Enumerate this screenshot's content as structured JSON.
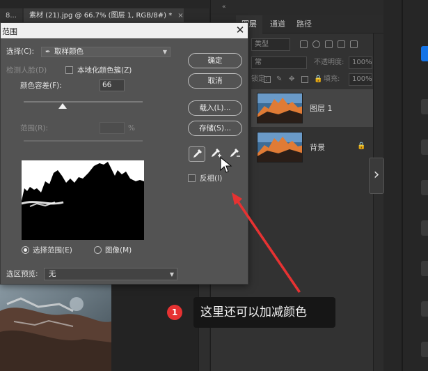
{
  "document_tabs": [
    {
      "label": "8..."
    },
    {
      "label": "素材 (21).jpg @ 66.7% (图层 1, RGB/8#) *",
      "close": "×"
    }
  ],
  "panel": {
    "tabs": [
      "图层",
      "通道",
      "路径"
    ],
    "filter_kind": "类型",
    "blend_mode": "常",
    "opacity_label": "不透明度:",
    "opacity_value": "100%",
    "lock_label": "锁定:",
    "fill_label": "填充:",
    "fill_value": "100%",
    "layers": [
      {
        "name": "图层 1",
        "selected": true
      },
      {
        "name": "背景",
        "locked": true
      }
    ]
  },
  "dialog": {
    "title": "范围",
    "select_label": "选择(C):",
    "select_value": "取样颜色",
    "detect_faces_label": "检测人脸(D)",
    "localized_clusters_label": "本地化颜色簇(Z)",
    "fuzziness_label": "颜色容差(F):",
    "fuzziness_value": "66",
    "fuzziness_level": 0.33,
    "range_label": "范围(R):",
    "range_unit": "%",
    "radio_selection": "选择范围(E)",
    "radio_image": "图像(M)",
    "preview_label": "选区预览:",
    "preview_value": "无",
    "buttons": {
      "ok": "确定",
      "cancel": "取消",
      "load": "载入(L)...",
      "save": "存储(S)..."
    },
    "invert_label": "反相(I)"
  },
  "annotation": {
    "badge": "1",
    "text": "这里还可以加减颜色"
  },
  "colors": {
    "accent": "#1473e6",
    "annotation_red": "#e63232",
    "dialog_bg": "#535353"
  }
}
